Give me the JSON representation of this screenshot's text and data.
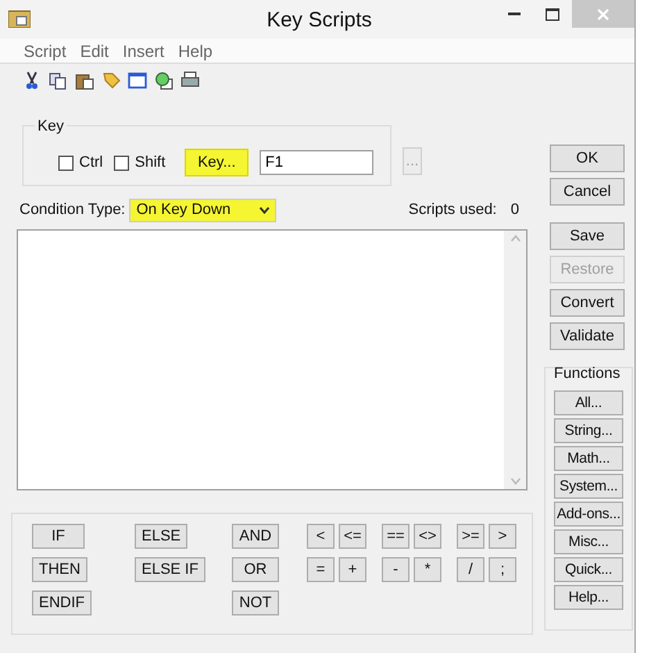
{
  "window": {
    "title": "Key Scripts"
  },
  "menu": [
    "Script",
    "Edit",
    "Insert",
    "Help"
  ],
  "key_group": {
    "title": "Key",
    "ctrl": {
      "label": "Ctrl",
      "checked": false
    },
    "shift": {
      "label": "Shift",
      "checked": false
    },
    "key_button": {
      "label": "Key...",
      "highlighted": true
    },
    "key_value": "F1",
    "browse_button": {
      "label": "...",
      "disabled": true
    }
  },
  "condition": {
    "label": "Condition Type:",
    "value": "On Key Down",
    "highlighted": true
  },
  "scripts_used": {
    "label": "Scripts used:",
    "value": "0"
  },
  "dialog_buttons": [
    {
      "label": "OK",
      "disabled": false
    },
    {
      "label": "Cancel",
      "disabled": false
    },
    {
      "label": "Save",
      "disabled": false
    },
    {
      "label": "Restore",
      "disabled": true
    },
    {
      "label": "Convert",
      "disabled": false
    },
    {
      "label": "Validate",
      "disabled": false
    }
  ],
  "functions": {
    "title": "Functions",
    "buttons": [
      "All...",
      "String...",
      "Math...",
      "System...",
      "Add-ons...",
      "Misc...",
      "Quick...",
      "Help..."
    ]
  },
  "logic_buttons": [
    [
      "IF",
      "THEN",
      "ENDIF"
    ],
    [
      "ELSE",
      "ELSE IF"
    ],
    [
      "AND",
      "OR",
      "NOT"
    ]
  ],
  "operator_buttons": [
    [
      "<",
      "<=",
      "==",
      "<>",
      ">=",
      ">"
    ],
    [
      "=",
      "+",
      "-",
      "*",
      "/",
      ";"
    ]
  ]
}
